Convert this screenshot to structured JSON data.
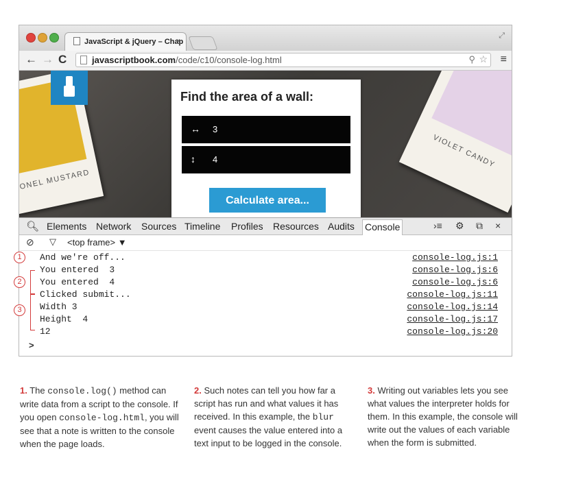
{
  "browser": {
    "tab_title": "JavaScript & jQuery – Chap",
    "tab_close": "×",
    "url_domain": "javascriptbook.com",
    "url_path": "/code/c10/console-log.html"
  },
  "page": {
    "swatch_left_name": "ONEL MUSTARD",
    "swatch_right_name": "VIOLET CANDY",
    "card_title": "Find the area of a wall:",
    "width_icon": "↔",
    "width_value": "3",
    "height_icon": "↕",
    "height_value": "4",
    "calculate_button": "Calculate area..."
  },
  "devtools": {
    "tabs": [
      "Elements",
      "Network",
      "Sources",
      "Timeline",
      "Profiles",
      "Resources",
      "Audits",
      "Console"
    ],
    "active_tab": "Console",
    "frame_selector": "<top frame> ▼"
  },
  "console": {
    "lines": [
      {
        "message": "And we're off...",
        "source": "console-log.js:1"
      },
      {
        "message": "You entered  3",
        "source": "console-log.js:6"
      },
      {
        "message": "You entered  4",
        "source": "console-log.js:6"
      },
      {
        "message": "Clicked submit...",
        "source": "console-log.js:11"
      },
      {
        "message": "Width 3",
        "source": "console-log.js:14"
      },
      {
        "message": "Height  4",
        "source": "console-log.js:17"
      },
      {
        "message": "12",
        "source": "console-log.js:20"
      }
    ],
    "prompt": ">"
  },
  "annotations": {
    "markers": [
      "1",
      "2",
      "3"
    ]
  },
  "captions": [
    {
      "num": "1.",
      "parts": [
        "The ",
        "console.log()",
        " method can write data from a script to the console. If you open ",
        "console-log.html",
        ", you will see that a note is written to the console when the page loads."
      ]
    },
    {
      "num": "2.",
      "parts": [
        "Such notes can tell you how far a script has run and what values it has received. In this example, the ",
        "blur",
        " event causes the value entered into a text input to be logged in the console."
      ]
    },
    {
      "num": "3.",
      "parts": [
        "Writing out variables lets you see what values the interpreter holds for them. In this example, the console will write out the values of each variable when the form is submitted."
      ]
    }
  ]
}
